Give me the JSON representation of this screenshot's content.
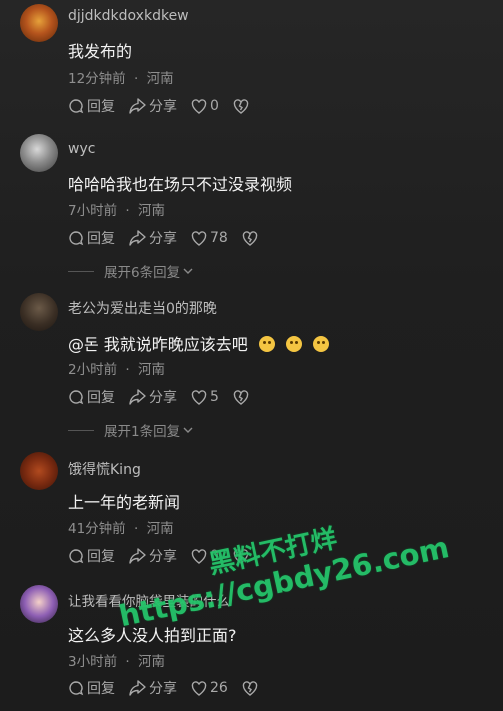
{
  "comments": [
    {
      "user": "djjdkdkdoxkdkew",
      "text": "我发布的",
      "time": "12分钟前",
      "location": "河南",
      "reply": "回复",
      "share": "分享",
      "likes": "0"
    },
    {
      "user": "wyc",
      "text": "哈哈哈我也在场只不过没录视频",
      "time": "7小时前",
      "location": "河南",
      "reply": "回复",
      "share": "分享",
      "likes": "78",
      "expand": "展开6条回复"
    },
    {
      "user": "老公为爱出走当0的那晚",
      "text": "@돈 我就说昨晚应该去吧",
      "time": "2小时前",
      "location": "河南",
      "reply": "回复",
      "share": "分享",
      "likes": "5",
      "expand": "展开1条回复"
    },
    {
      "user": "饿得慌King",
      "text": "上一年的老新闻",
      "time": "41分钟前",
      "location": "河南",
      "reply": "回复",
      "share": "分享",
      "likes": "0"
    },
    {
      "user": "让我看看你脑袋里装的什么",
      "text": "这么多人没人拍到正面?",
      "time": "3小时前",
      "location": "河南",
      "reply": "回复",
      "share": "分享",
      "likes": "26"
    }
  ],
  "separator": "·",
  "watermark": {
    "line1": "黑料不打烊",
    "line2": "https://cgbdy26.com"
  },
  "icons": [
    "reply-icon",
    "share-icon",
    "like-heart-icon",
    "dislike-heart-icon",
    "chevron-down-icon"
  ]
}
